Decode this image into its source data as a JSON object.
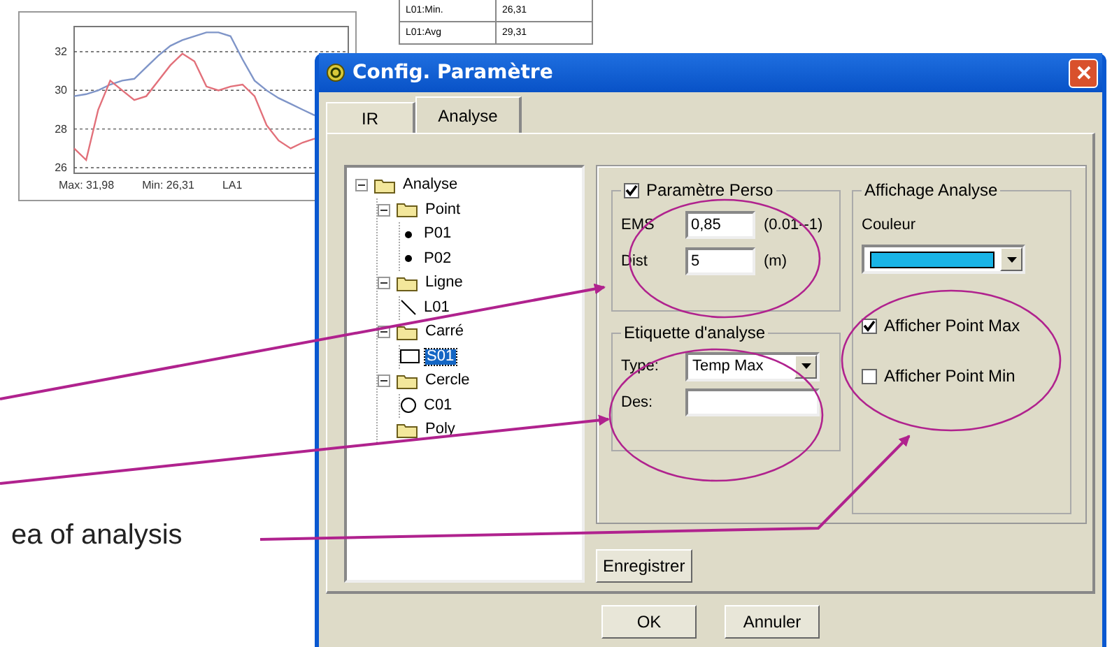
{
  "background_chart": {
    "chart_data": {
      "type": "line",
      "grid": true,
      "ylim": [
        26,
        33.3
      ],
      "yticks": [
        26,
        28,
        30,
        32
      ],
      "categories": [
        null,
        null,
        null,
        null,
        null,
        null,
        null,
        null,
        null,
        null,
        null,
        null,
        null,
        null,
        null,
        null,
        null,
        null,
        null,
        null,
        null
      ],
      "series": [
        {
          "color": "#7f95c8",
          "values": [
            29.7,
            29.8,
            30.0,
            30.3,
            30.5,
            30.6,
            31.2,
            31.8,
            32.3,
            32.6,
            32.8,
            33.0,
            33.0,
            32.8,
            31.6,
            30.5,
            30.0,
            29.6,
            29.3,
            29.0,
            28.7
          ]
        },
        {
          "color": "#e2707a",
          "values": [
            27.0,
            26.4,
            29.0,
            30.5,
            30.0,
            29.5,
            29.7,
            30.5,
            31.3,
            31.9,
            31.5,
            30.2,
            30.0,
            30.2,
            30.3,
            29.7,
            28.2,
            27.4,
            27.0,
            27.3,
            27.5
          ]
        }
      ]
    },
    "footer": [
      "Max: 31,98",
      "Min: 26,31",
      "LA1"
    ]
  },
  "stats_table": {
    "rows": [
      [
        "L01:Min.",
        "26,31"
      ],
      [
        "L01:Avg",
        "29,31"
      ]
    ]
  },
  "dialog": {
    "title": "Config. Paramètre",
    "tabs": [
      {
        "label": "IR",
        "selected": false
      },
      {
        "label": "Analyse",
        "selected": true
      }
    ],
    "tree": [
      {
        "label": "Analyse",
        "expanded": true,
        "selected": false,
        "children": [
          {
            "label": "Point",
            "expanded": true,
            "selected": false,
            "children": [
              {
                "label": "P01",
                "kind": "dot",
                "selected": false
              },
              {
                "label": "P02",
                "kind": "dot",
                "selected": false
              }
            ]
          },
          {
            "label": "Ligne",
            "expanded": true,
            "selected": false,
            "children": [
              {
                "label": "L01",
                "kind": "line",
                "selected": false
              }
            ]
          },
          {
            "label": "Carré",
            "expanded": true,
            "selected": false,
            "children": [
              {
                "label": "S01",
                "kind": "square",
                "selected": true
              }
            ]
          },
          {
            "label": "Cercle",
            "expanded": true,
            "selected": false,
            "children": [
              {
                "label": "C01",
                "kind": "circle",
                "selected": false
              }
            ]
          },
          {
            "label": "Poly",
            "selected": false
          }
        ]
      }
    ],
    "parametre_perso": {
      "label": "Paramètre Perso",
      "checked": true,
      "fields": [
        {
          "label": "EMS",
          "value": "0,85",
          "unit": "(0.01--1)"
        },
        {
          "label": "Dist",
          "value": "5",
          "unit": "(m)"
        }
      ]
    },
    "etiquette": {
      "title": "Etiquette d'analyse",
      "type_label": "Type:",
      "type_value": "Temp Max",
      "des_label": "Des:"
    },
    "affichage": {
      "title": "Affichage Analyse",
      "couleur_label": "Couleur",
      "color": "#1ab4e6",
      "checkboxes": [
        {
          "label": "Afficher Point Max",
          "checked": true
        },
        {
          "label": "Afficher Point Min",
          "checked": false
        }
      ]
    },
    "save_button": "Enregistrer",
    "buttons": [
      "OK",
      "Annuler"
    ]
  },
  "annotation": {
    "caption": "ea of analysis"
  }
}
